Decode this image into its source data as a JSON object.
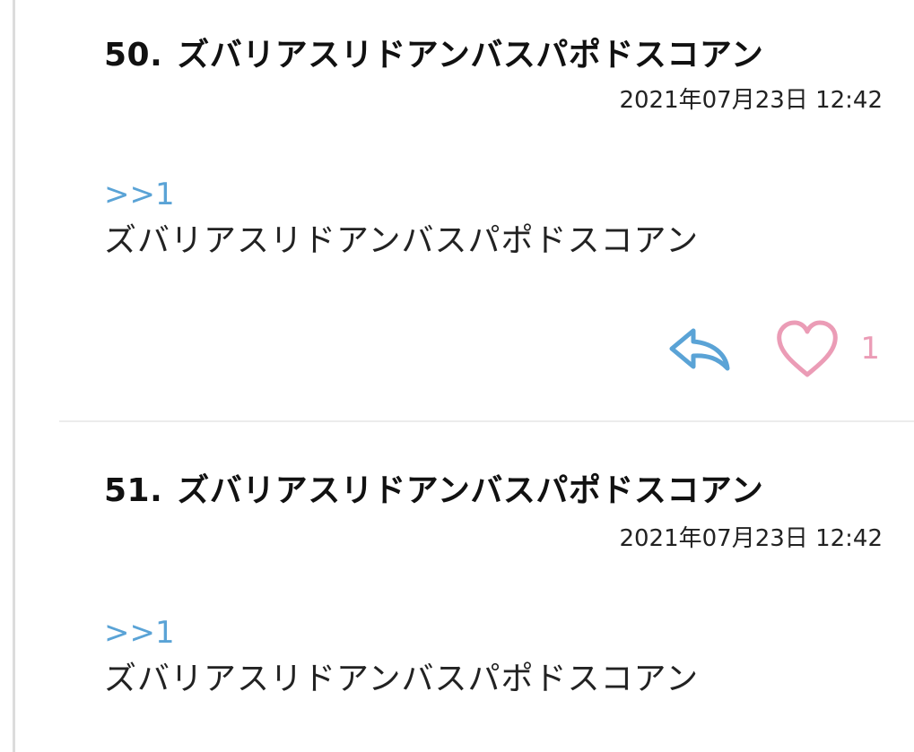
{
  "posts": [
    {
      "number": "50.",
      "title": "ズバリアスリドアンバスパポドスコアン",
      "date": "2021年07月23日 12:42",
      "reply_ref": ">>1",
      "body": "ズバリアスリドアンバスパポドスコアン",
      "like_count": "1"
    },
    {
      "number": "51.",
      "title": "ズバリアスリドアンバスパポドスコアン",
      "date": "2021年07月23日 12:42",
      "reply_ref": ">>1",
      "body": "ズバリアスリドアンバスパポドスコアン"
    }
  ],
  "icons": {
    "reply": "reply-arrow-icon",
    "like": "heart-icon"
  },
  "colors": {
    "link": "#5aa3d6",
    "reply_icon": "#5aa3d6",
    "heart": "#eb9cb6"
  }
}
